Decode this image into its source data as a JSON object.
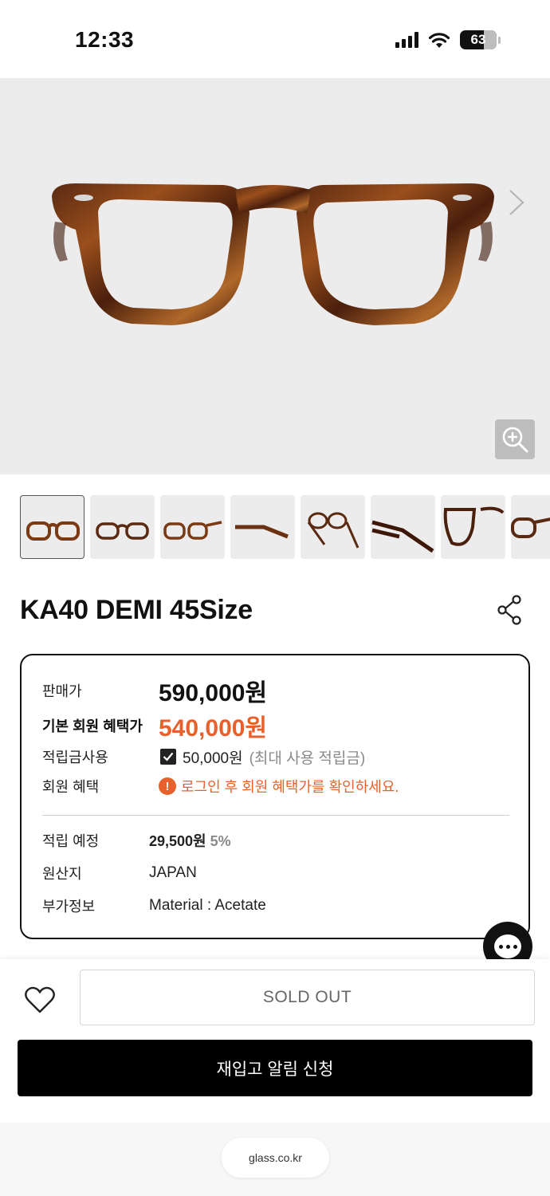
{
  "status": {
    "time": "12:33",
    "battery": "63"
  },
  "icons": {
    "signal": "signal-icon",
    "wifi": "wifi-icon",
    "battery": "battery-icon",
    "next": "chevron-right-icon",
    "zoom": "zoom-in-icon",
    "share": "share-icon",
    "check": "check-icon",
    "notice": "info-icon",
    "chat": "chat-icon",
    "wish": "heart-icon"
  },
  "product": {
    "title": "KA40 DEMI 45Size"
  },
  "pricing": {
    "sale_label": "판매가",
    "sale_price": "590,000원",
    "member_label": "기본 회원 혜택가",
    "member_price": "540,000원",
    "points_use_label": "적립금사용",
    "points_use_value": "50,000원",
    "points_use_note": "(최대 사용 적립금)",
    "benefit_label": "회원 혜택",
    "notice_icon_text": "!",
    "benefit_notice": "로그인 후 회원 혜택가를 확인하세요.",
    "reward_label": "적립 예정",
    "reward_value": "29,500원",
    "reward_rate": "5%",
    "origin_label": "원산지",
    "origin_value": "JAPAN",
    "extra_label": "부가정보",
    "extra_value": "Material : Acetate"
  },
  "actions": {
    "sold_out": "SOLD OUT",
    "restock": "재입고 알림 신청"
  },
  "browser": {
    "url": "glass.co.kr"
  },
  "colors": {
    "accent": "#e8612c",
    "primary_button": "#000000"
  }
}
